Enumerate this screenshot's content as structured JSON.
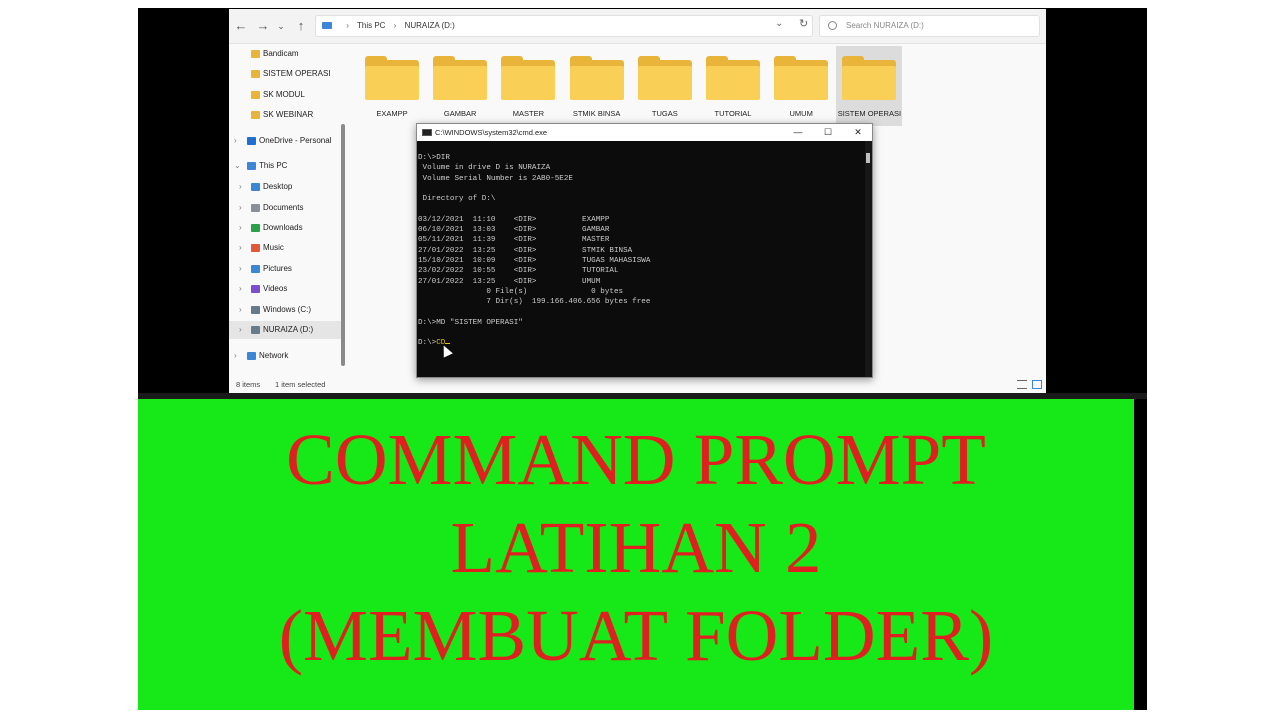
{
  "explorer": {
    "path": [
      "This PC",
      "NURAIZA (D:)"
    ],
    "search_placeholder": "Search NURAIZA (D:)",
    "sidebar": [
      {
        "label": "Bandicam",
        "icon": "folder-icon",
        "color": "#e8b53a"
      },
      {
        "label": "SISTEM OPERASI",
        "icon": "folder-icon",
        "color": "#e8b53a"
      },
      {
        "label": "SK MODUL",
        "icon": "folder-icon",
        "color": "#e8b53a"
      },
      {
        "label": "SK WEBINAR",
        "icon": "folder-icon",
        "color": "#e8b53a"
      },
      {
        "label": "OneDrive - Personal",
        "icon": "cloud-icon",
        "color": "#1e6fd0"
      },
      {
        "label": "This PC",
        "icon": "pc-icon",
        "color": "#3b86d6"
      },
      {
        "label": "Desktop",
        "icon": "desktop-icon",
        "color": "#3b86d6"
      },
      {
        "label": "Documents",
        "icon": "documents-icon",
        "color": "#8a8f98"
      },
      {
        "label": "Downloads",
        "icon": "downloads-icon",
        "color": "#2aa04a"
      },
      {
        "label": "Music",
        "icon": "music-icon",
        "color": "#e05a3a"
      },
      {
        "label": "Pictures",
        "icon": "pictures-icon",
        "color": "#3b86d6"
      },
      {
        "label": "Videos",
        "icon": "videos-icon",
        "color": "#7a4fd0"
      },
      {
        "label": "Windows (C:)",
        "icon": "drive-icon",
        "color": "#6a7a8a"
      },
      {
        "label": "NURAIZA (D:)",
        "icon": "drive-icon",
        "color": "#6a7a8a"
      },
      {
        "label": "Network",
        "icon": "network-icon",
        "color": "#3b86d6"
      }
    ],
    "folders": [
      "EXAMPP",
      "GAMBAR",
      "MASTER",
      "STMIK BINSA",
      "TUGAS",
      "TUTORIAL",
      "UMUM",
      "SISTEM OPERASI"
    ],
    "status_count": "8 items",
    "status_selected": "1 item selected"
  },
  "cmd": {
    "title": "C:\\WINDOWS\\system32\\cmd.exe",
    "lines": [
      "D:\\>DIR",
      " Volume in drive D is NURAIZA",
      " Volume Serial Number is 2AB0-5E2E",
      "",
      " Directory of D:\\",
      "",
      "03/12/2021  11:10    <DIR>          EXAMPP",
      "06/10/2021  13:03    <DIR>          GAMBAR",
      "05/11/2021  11:39    <DIR>          MASTER",
      "27/01/2022  13:25    <DIR>          STMIK BINSA",
      "15/10/2021  10:09    <DIR>          TUGAS MAHASISWA",
      "23/02/2022  10:55    <DIR>          TUTORIAL",
      "27/01/2022  13:25    <DIR>          UMUM",
      "               0 File(s)              0 bytes",
      "               7 Dir(s)  199.166.406.656 bytes free",
      "",
      "D:\\>MD \"SISTEM OPERASI\"",
      ""
    ],
    "prompt": "D:\\>",
    "typed": "CD"
  },
  "banner": {
    "line1": "COMMAND PROMPT",
    "line2": "LATIHAN 2",
    "line3": "(MEMBUAT FOLDER)"
  }
}
